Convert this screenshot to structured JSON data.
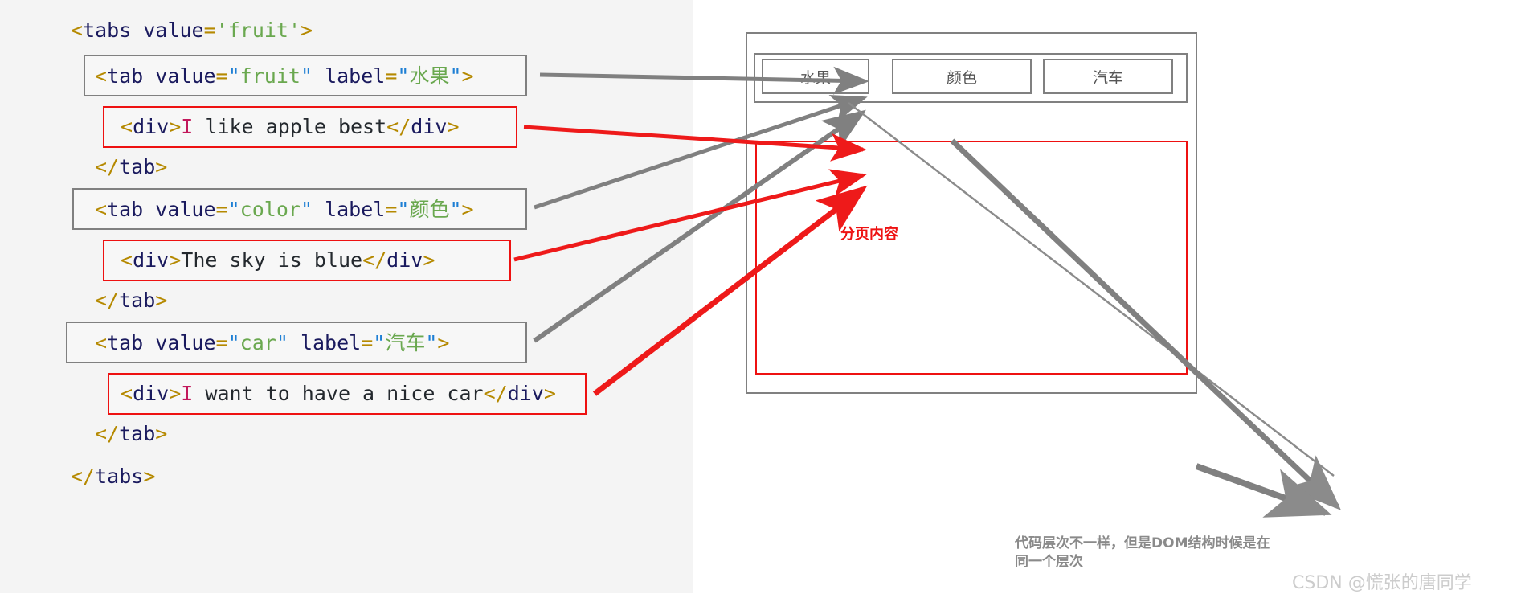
{
  "code": {
    "lines": [
      {
        "indent": 0,
        "tokens": [
          {
            "t": "punct",
            "v": "<"
          },
          {
            "t": "tag",
            "v": "tabs"
          },
          {
            "t": "text",
            "v": " "
          },
          {
            "t": "attr",
            "v": "value"
          },
          {
            "t": "eq",
            "v": "="
          },
          {
            "t": "str",
            "v": "'fruit'"
          },
          {
            "t": "punct",
            "v": ">"
          }
        ]
      },
      {
        "indent": 1,
        "tokens": [
          {
            "t": "punct",
            "v": "<"
          },
          {
            "t": "tag",
            "v": "tab"
          },
          {
            "t": "text",
            "v": " "
          },
          {
            "t": "attr",
            "v": "value"
          },
          {
            "t": "eq",
            "v": "="
          },
          {
            "t": "quote",
            "v": "\""
          },
          {
            "t": "str",
            "v": "fruit"
          },
          {
            "t": "quote",
            "v": "\""
          },
          {
            "t": "text",
            "v": " "
          },
          {
            "t": "attr",
            "v": "label"
          },
          {
            "t": "eq",
            "v": "="
          },
          {
            "t": "quote",
            "v": "\""
          },
          {
            "t": "str",
            "v": "水果"
          },
          {
            "t": "quote",
            "v": "\""
          },
          {
            "t": "punct",
            "v": ">"
          }
        ]
      },
      {
        "indent": 2,
        "tokens": [
          {
            "t": "punct",
            "v": "<"
          },
          {
            "t": "tag",
            "v": "div"
          },
          {
            "t": "punct",
            "v": ">"
          },
          {
            "t": "pink",
            "v": "I"
          },
          {
            "t": "text",
            "v": " like apple best"
          },
          {
            "t": "punct",
            "v": "</"
          },
          {
            "t": "tag",
            "v": "div"
          },
          {
            "t": "punct",
            "v": ">"
          }
        ]
      },
      {
        "indent": 1,
        "tokens": [
          {
            "t": "punct",
            "v": "</"
          },
          {
            "t": "tag",
            "v": "tab"
          },
          {
            "t": "punct",
            "v": ">"
          }
        ]
      },
      {
        "indent": 1,
        "tokens": [
          {
            "t": "punct",
            "v": "<"
          },
          {
            "t": "tag",
            "v": "tab"
          },
          {
            "t": "text",
            "v": " "
          },
          {
            "t": "attr",
            "v": "value"
          },
          {
            "t": "eq",
            "v": "="
          },
          {
            "t": "quote",
            "v": "\""
          },
          {
            "t": "str",
            "v": "color"
          },
          {
            "t": "quote",
            "v": "\""
          },
          {
            "t": "text",
            "v": " "
          },
          {
            "t": "attr",
            "v": "label"
          },
          {
            "t": "eq",
            "v": "="
          },
          {
            "t": "quote",
            "v": "\""
          },
          {
            "t": "str",
            "v": "颜色"
          },
          {
            "t": "quote",
            "v": "\""
          },
          {
            "t": "punct",
            "v": ">"
          }
        ]
      },
      {
        "indent": 2,
        "tokens": [
          {
            "t": "punct",
            "v": "<"
          },
          {
            "t": "tag",
            "v": "div"
          },
          {
            "t": "punct",
            "v": ">"
          },
          {
            "t": "text",
            "v": "The sky is blue"
          },
          {
            "t": "punct",
            "v": "</"
          },
          {
            "t": "tag",
            "v": "div"
          },
          {
            "t": "punct",
            "v": ">"
          }
        ]
      },
      {
        "indent": 1,
        "tokens": [
          {
            "t": "punct",
            "v": "</"
          },
          {
            "t": "tag",
            "v": "tab"
          },
          {
            "t": "punct",
            "v": ">"
          }
        ]
      },
      {
        "indent": 1,
        "tokens": [
          {
            "t": "punct",
            "v": "<"
          },
          {
            "t": "tag",
            "v": "tab"
          },
          {
            "t": "text",
            "v": " "
          },
          {
            "t": "attr",
            "v": "value"
          },
          {
            "t": "eq",
            "v": "="
          },
          {
            "t": "quote",
            "v": "\""
          },
          {
            "t": "str",
            "v": "car"
          },
          {
            "t": "quote",
            "v": "\""
          },
          {
            "t": "text",
            "v": " "
          },
          {
            "t": "attr",
            "v": "label"
          },
          {
            "t": "eq",
            "v": "="
          },
          {
            "t": "quote",
            "v": "\""
          },
          {
            "t": "str",
            "v": "汽车"
          },
          {
            "t": "quote",
            "v": "\""
          },
          {
            "t": "punct",
            "v": ">"
          }
        ]
      },
      {
        "indent": 2,
        "tokens": [
          {
            "t": "punct",
            "v": "<"
          },
          {
            "t": "tag",
            "v": "div"
          },
          {
            "t": "punct",
            "v": ">"
          },
          {
            "t": "pink",
            "v": "I"
          },
          {
            "t": "text",
            "v": " want to have a nice car"
          },
          {
            "t": "punct",
            "v": "</"
          },
          {
            "t": "tag",
            "v": "div"
          },
          {
            "t": "punct",
            "v": ">"
          }
        ]
      },
      {
        "indent": 1,
        "tokens": [
          {
            "t": "punct",
            "v": "</"
          },
          {
            "t": "tag",
            "v": "tab"
          },
          {
            "t": "punct",
            "v": ">"
          }
        ]
      },
      {
        "indent": 0,
        "tokens": [
          {
            "t": "punct",
            "v": "</"
          },
          {
            "t": "tag",
            "v": "tabs"
          },
          {
            "t": "punct",
            "v": ">"
          }
        ]
      }
    ],
    "plain": [
      "<tabs value='fruit'>",
      "<tab value=\"fruit\" label=\"水果\">",
      "<div>I like apple best</div>",
      "</tab>",
      "<tab value=\"color\" label=\"颜色\">",
      "<div>The sky is blue</div>",
      "</tab>",
      "<tab value=\"car\" label=\"汽车\">",
      "<div>I want to have a nice car</div>",
      "</tab>",
      "</tabs>"
    ]
  },
  "mock": {
    "tabs": [
      {
        "label": "水果",
        "value": "fruit"
      },
      {
        "label": "颜色",
        "value": "color"
      },
      {
        "label": "汽车",
        "value": "car"
      }
    ],
    "content_label": "分页内容"
  },
  "annotation": {
    "note_line1": "代码层次不一样，但是DOM结构时候是在",
    "note_line2": "同一个层次"
  },
  "watermark": {
    "text": "CSDN @慌张的唐同学"
  },
  "colors": {
    "code_bg": "#f4f4f4",
    "gray_stroke": "#808080",
    "red_stroke": "#ee1111",
    "arrow_gray": "#808080",
    "arrow_red": "#ee1a1a",
    "label_red": "#ee1111",
    "note_gray": "#8a8a8a",
    "watermark_gray": "#cccccc",
    "str_green": "#6aa84f",
    "tag_navy": "#1a1a5e",
    "punct_gold": "#b58900",
    "quote_blue": "#1e7fd4",
    "pink": "#c2185b"
  }
}
